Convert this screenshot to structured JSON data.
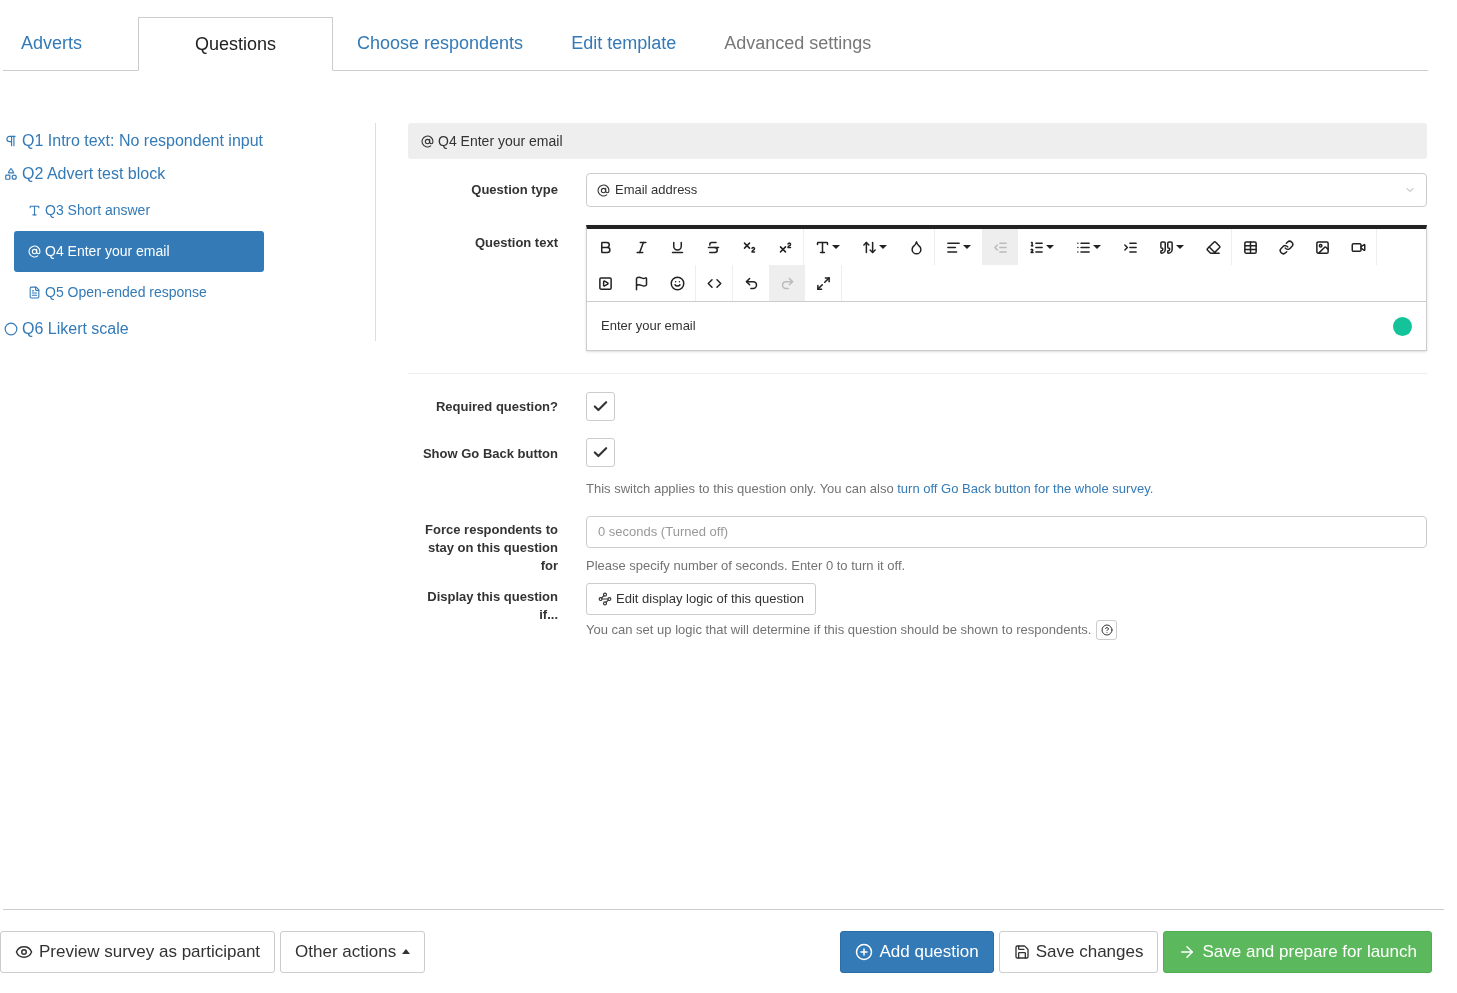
{
  "tabs": [
    {
      "label": "Adverts",
      "selected": false,
      "disabled": false
    },
    {
      "label": "Questions",
      "selected": true,
      "disabled": false
    },
    {
      "label": "Choose respondents",
      "selected": false,
      "disabled": false
    },
    {
      "label": "Edit template",
      "selected": false,
      "disabled": false
    },
    {
      "label": "Advanced settings",
      "selected": false,
      "disabled": true
    }
  ],
  "sidebar": {
    "items": [
      {
        "kind": "intro",
        "number": "Q1",
        "label": "Intro text: No respondent input",
        "selected": false
      },
      {
        "kind": "block",
        "number": "Q2",
        "label": "Advert test block",
        "selected": false,
        "children": [
          {
            "kind": "short",
            "number": "Q3",
            "label": "Short answer",
            "selected": false
          },
          {
            "kind": "email",
            "number": "Q4",
            "label": "Enter your email",
            "selected": true
          },
          {
            "kind": "open",
            "number": "Q5",
            "label": "Open-ended response",
            "selected": false
          }
        ]
      },
      {
        "kind": "likert",
        "number": "Q6",
        "label": "Likert scale",
        "selected": false
      }
    ]
  },
  "editor": {
    "header": {
      "number": "Q4",
      "title": "Enter your email"
    },
    "question_type": {
      "label": "Question type",
      "value": "Email address"
    },
    "question_text": {
      "label": "Question text",
      "value": "Enter your email",
      "toolbar": {
        "rows": [
          [
            [
              {
                "kind": "bold",
                "disabled": false,
                "dropdown": false
              },
              {
                "kind": "italic",
                "disabled": false,
                "dropdown": false
              },
              {
                "kind": "underline",
                "disabled": false,
                "dropdown": false
              },
              {
                "kind": "strike",
                "disabled": false,
                "dropdown": false
              },
              {
                "kind": "subscript",
                "disabled": false,
                "dropdown": false
              },
              {
                "kind": "superscript",
                "disabled": false,
                "dropdown": false
              }
            ],
            [
              {
                "kind": "fontsize",
                "disabled": false,
                "dropdown": true
              },
              {
                "kind": "lineheight",
                "disabled": false,
                "dropdown": true
              },
              {
                "kind": "color",
                "disabled": false,
                "dropdown": false
              }
            ],
            [
              {
                "kind": "align",
                "disabled": false,
                "dropdown": true
              },
              {
                "kind": "outdent",
                "disabled": true,
                "dropdown": false
              },
              {
                "kind": "ol",
                "disabled": false,
                "dropdown": true
              },
              {
                "kind": "ul",
                "disabled": false,
                "dropdown": true
              },
              {
                "kind": "indent",
                "disabled": false,
                "dropdown": false
              },
              {
                "kind": "quote",
                "disabled": false,
                "dropdown": true
              },
              {
                "kind": "eraser",
                "disabled": false,
                "dropdown": false
              }
            ],
            [
              {
                "kind": "table",
                "disabled": false,
                "dropdown": false
              },
              {
                "kind": "link",
                "disabled": false,
                "dropdown": false
              },
              {
                "kind": "image",
                "disabled": false,
                "dropdown": false
              },
              {
                "kind": "video",
                "disabled": false,
                "dropdown": false
              }
            ]
          ],
          [
            [
              {
                "kind": "media",
                "disabled": false,
                "dropdown": false
              },
              {
                "kind": "flag",
                "disabled": false,
                "dropdown": false
              },
              {
                "kind": "emoji",
                "disabled": false,
                "dropdown": false
              }
            ],
            [
              {
                "kind": "code",
                "disabled": false,
                "dropdown": false
              }
            ],
            [
              {
                "kind": "undo",
                "disabled": false,
                "dropdown": false
              },
              {
                "kind": "redo",
                "disabled": true,
                "dropdown": false
              },
              {
                "kind": "fullscreen",
                "disabled": false,
                "dropdown": false
              }
            ]
          ]
        ]
      }
    },
    "required": {
      "label": "Required question?",
      "checked": true
    },
    "go_back": {
      "label": "Show Go Back button",
      "checked": true,
      "help": "This switch applies to this question only. You can also ",
      "help_link": "turn off Go Back button for the whole survey",
      "help_end": "."
    },
    "force_stay": {
      "label": "Force respondents to stay on this question for",
      "placeholder": "0 seconds (Turned off)",
      "help": "Please specify number of seconds. Enter 0 to turn it off."
    },
    "display_logic": {
      "label": "Display this question if...",
      "button": "Edit display logic of this question",
      "help": "You can set up logic that will determine if this question should be shown to respondents."
    }
  },
  "footer": {
    "left": [
      {
        "kind": "preview",
        "label": "Preview survey as participant"
      },
      {
        "kind": "menu",
        "label": "Other actions"
      }
    ],
    "right": [
      {
        "kind": "add",
        "label": "Add question"
      },
      {
        "kind": "save",
        "label": "Save changes"
      },
      {
        "kind": "launch",
        "label": "Save and prepare for launch"
      }
    ]
  }
}
